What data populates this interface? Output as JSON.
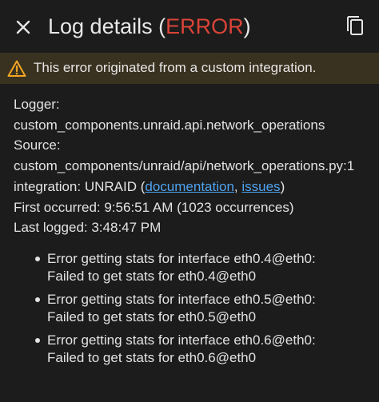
{
  "header": {
    "title_prefix": "Log details (",
    "title_level": "ERROR",
    "title_suffix": ")",
    "close_icon": "close-icon",
    "copy_icon": "copy-icon",
    "error_color": "#db4437"
  },
  "warning": {
    "icon": "warning-icon",
    "text": "This error originated from a custom integration.",
    "icon_color": "#f5a623"
  },
  "details": {
    "logger_label": "Logger:",
    "logger_value": "custom_components.unraid.api.network_operations",
    "source_label": "Source:",
    "source_value": "custom_components/unraid/api/network_operations.py:1",
    "integration_prefix": "integration: UNRAID (",
    "documentation_link": "documentation",
    "separator": ", ",
    "issues_link": "issues",
    "integration_suffix": ")",
    "first_occurred": "First occurred: 9:56:51 AM (1023 occurrences)",
    "last_logged": "Last logged: 3:48:47 PM",
    "link_color": "#4fa3f0"
  },
  "errors": [
    {
      "line1": "Error getting stats for interface eth0.4@eth0:",
      "line2": "Failed to get stats for eth0.4@eth0"
    },
    {
      "line1": "Error getting stats for interface eth0.5@eth0:",
      "line2": "Failed to get stats for eth0.5@eth0"
    },
    {
      "line1": "Error getting stats for interface eth0.6@eth0:",
      "line2": "Failed to get stats for eth0.6@eth0"
    }
  ]
}
